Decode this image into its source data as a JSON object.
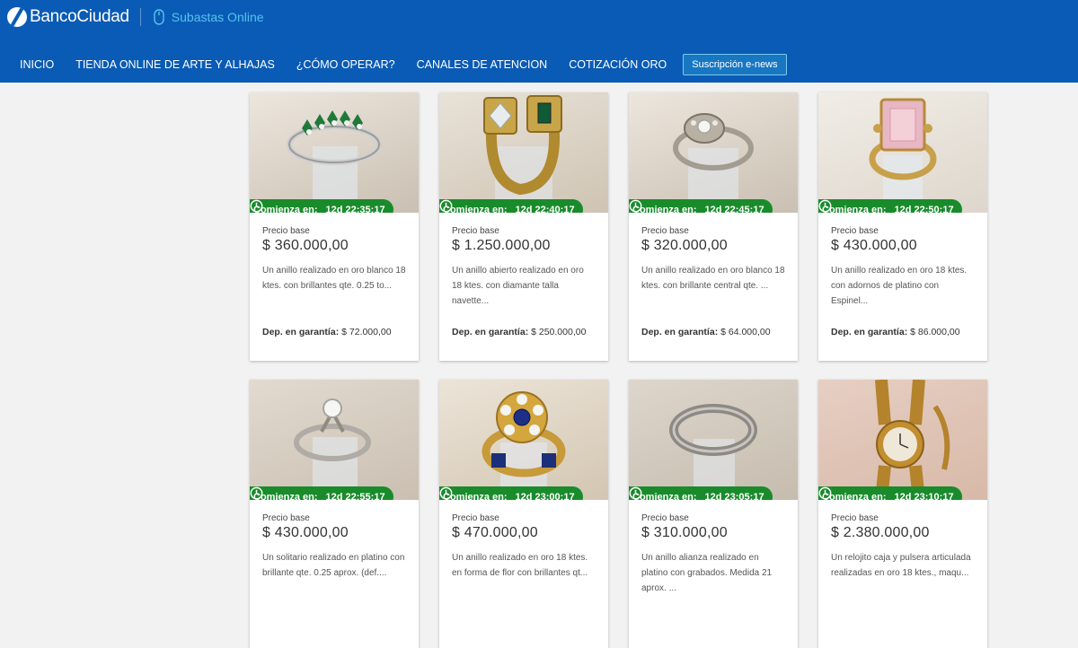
{
  "brand": {
    "name": "BancoCiudad",
    "sub_label": "Subastas Online",
    "colors": {
      "header_bg": "#0a5bb5",
      "sub_label": "#55c4ee",
      "timer_badge": "#198b2b"
    }
  },
  "nav": {
    "items": [
      {
        "label": "INICIO"
      },
      {
        "label": "TIENDA ONLINE DE ARTE Y ALHAJAS"
      },
      {
        "label": "¿CÓMO OPERAR?"
      },
      {
        "label": "CANALES DE ATENCION"
      },
      {
        "label": "COTIZACIÓN ORO"
      }
    ],
    "subscribe_button": "Suscripción e-news"
  },
  "lots": [
    {
      "timer_label": "Comienza en:",
      "timer_value": "12d 22:35:17",
      "price_label": "Precio base",
      "price": "$ 360.000,00",
      "description": "Un anillo realizado en oro blanco 18 ktes. con brillantes qte. 0.25 to...",
      "deposit_label": "Dep. en garantía:",
      "deposit_value": "$ 72.000,00",
      "image": "emerald-band-ring"
    },
    {
      "timer_label": "Comienza en:",
      "timer_value": "12d 22:40:17",
      "price_label": "Precio base",
      "price": "$ 1.250.000,00",
      "description": "Un anillo abierto realizado en oro 18 ktes. con diamante talla navette...",
      "deposit_label": "Dep. en garantía:",
      "deposit_value": "$ 250.000,00",
      "image": "open-gold-ring"
    },
    {
      "timer_label": "Comienza en:",
      "timer_value": "12d 22:45:17",
      "price_label": "Precio base",
      "price": "$ 320.000,00",
      "description": "Un anillo realizado en oro blanco 18 ktes. con brillante central qte. ...",
      "deposit_label": "Dep. en garantía:",
      "deposit_value": "$ 64.000,00",
      "image": "white-gold-ring"
    },
    {
      "timer_label": "Comienza en:",
      "timer_value": "12d 22:50:17",
      "price_label": "Precio base",
      "price": "$ 430.000,00",
      "description": "Un anillo realizado en oro 18 ktes. con adornos de platino con Espinel...",
      "deposit_label": "Dep. en garantía:",
      "deposit_value": "$ 86.000,00",
      "image": "pink-spinel-ring"
    },
    {
      "timer_label": "Comienza en:",
      "timer_value": "12d 22:55:17",
      "price_label": "Precio base",
      "price": "$ 430.000,00",
      "description": "Un solitario realizado en platino con brillante qte. 0.25 aprox. (def....",
      "deposit_label": "",
      "deposit_value": "",
      "image": "solitaire-ring"
    },
    {
      "timer_label": "Comienza en:",
      "timer_value": "12d 23:00:17",
      "price_label": "Precio base",
      "price": "$ 470.000,00",
      "description": "Un anillo realizado en oro 18 ktes. en forma de flor con brillantes qt...",
      "deposit_label": "",
      "deposit_value": "",
      "image": "flower-sapphire-ring"
    },
    {
      "timer_label": "Comienza en:",
      "timer_value": "12d 23:05:17",
      "price_label": "Precio base",
      "price": "$ 310.000,00",
      "description": "Un anillo alianza realizado en platino con grabados. Medida 21 aprox. ...",
      "deposit_label": "",
      "deposit_value": "",
      "image": "platinum-band"
    },
    {
      "timer_label": "Comienza en:",
      "timer_value": "12d 23:10:17",
      "price_label": "Precio base",
      "price": "$ 2.380.000,00",
      "description": "Un relojito caja y pulsera articulada realizadas en oro 18 ktes., maqu...",
      "deposit_label": "",
      "deposit_value": "",
      "image": "gold-watch"
    }
  ]
}
